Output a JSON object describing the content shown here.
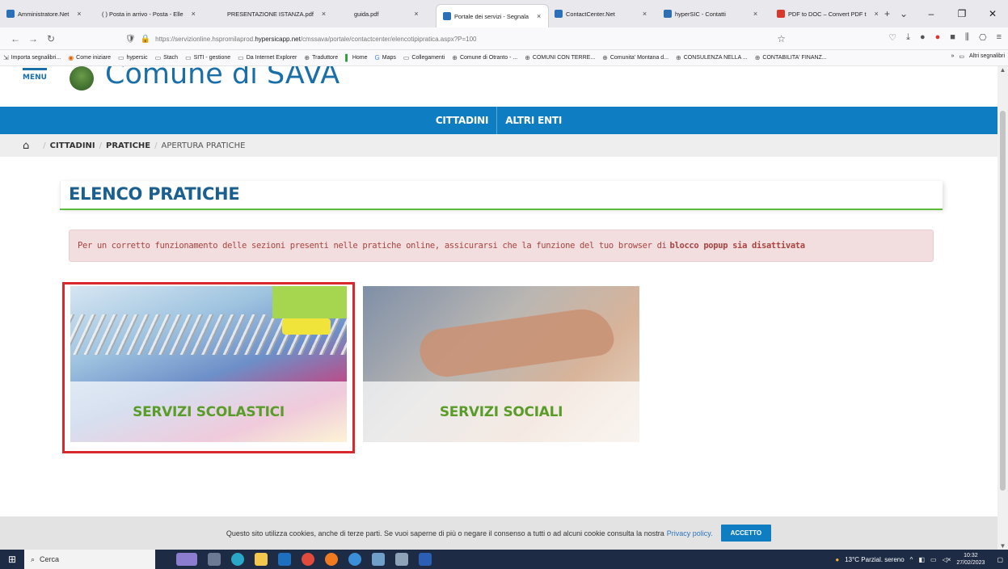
{
  "browser": {
    "tabs": [
      {
        "title": "Amministratore.Net",
        "close": "×"
      },
      {
        "title": "( ) Posta in arrivo - Posta - Elle",
        "close": "×"
      },
      {
        "title": "PRESENTAZIONE ISTANZA.pdf",
        "close": "×"
      },
      {
        "title": "guida.pdf",
        "close": "×"
      },
      {
        "title": "Portale dei servizi - Segnala",
        "close": "×"
      },
      {
        "title": "ContactCenter.Net",
        "close": "×"
      },
      {
        "title": "hyperSIC - Contatti",
        "close": "×"
      },
      {
        "title": "PDF to DOC – Convert PDF t",
        "close": "×"
      }
    ],
    "url_prefix": "https://servizionline.hspromilaprod.",
    "url_host": "hypersicapp.net",
    "url_path": "/cmssava/portale/contactcenter/elencotipipratica.aspx?P=100",
    "bookmarks": [
      "Importa segnalibri...",
      "Come iniziare",
      "hypersic",
      "Stach",
      "SITI - gestione",
      "Da Internet Explorer",
      "Traduttore",
      "Home",
      "Maps",
      "Collegamenti",
      "Comune di Otranto - ...",
      "COMUNI CON TERRE...",
      "Comunita' Montana d...",
      "CONSULENZA NELLA ...",
      "CONTABILITA' FINANZ..."
    ],
    "bookmarks_other": "Altri segnalibri"
  },
  "site": {
    "menu_label": "MENU",
    "title": "Comune di SAVA",
    "nav": [
      "CITTADINI",
      "ALTRI ENTI"
    ],
    "breadcrumb": [
      "CITTADINI",
      "PRATICHE",
      "APERTURA PRATICHE"
    ],
    "heading": "ELENCO PRATICHE",
    "alert_pre": "Per un corretto funzionamento delle sezioni presenti nelle pratiche online, assicurarsi che la funzione del tuo browser di",
    "alert_bold": "blocco popup sia disattivata",
    "cards": [
      {
        "label": "SERVIZI SCOLASTICI"
      },
      {
        "label": "SERVIZI SOCIALI"
      }
    ],
    "cookie_text": "Questo sito utilizza cookies, anche di terze parti. Se vuoi saperne di più o negare il consenso a tutti o ad alcuni cookie consulta la nostra",
    "cookie_link": "Privacy policy.",
    "cookie_button": "ACCETTO"
  },
  "taskbar": {
    "search_placeholder": "Cerca",
    "weather": "13°C  Parzial. sereno",
    "time": "10:32",
    "date": "27/02/2023"
  },
  "colors": {
    "brand_blue": "#0e7dc2",
    "heading_blue": "#1a5f8f",
    "green_label": "#5a9c2a",
    "highlight_red": "#d8272d"
  }
}
